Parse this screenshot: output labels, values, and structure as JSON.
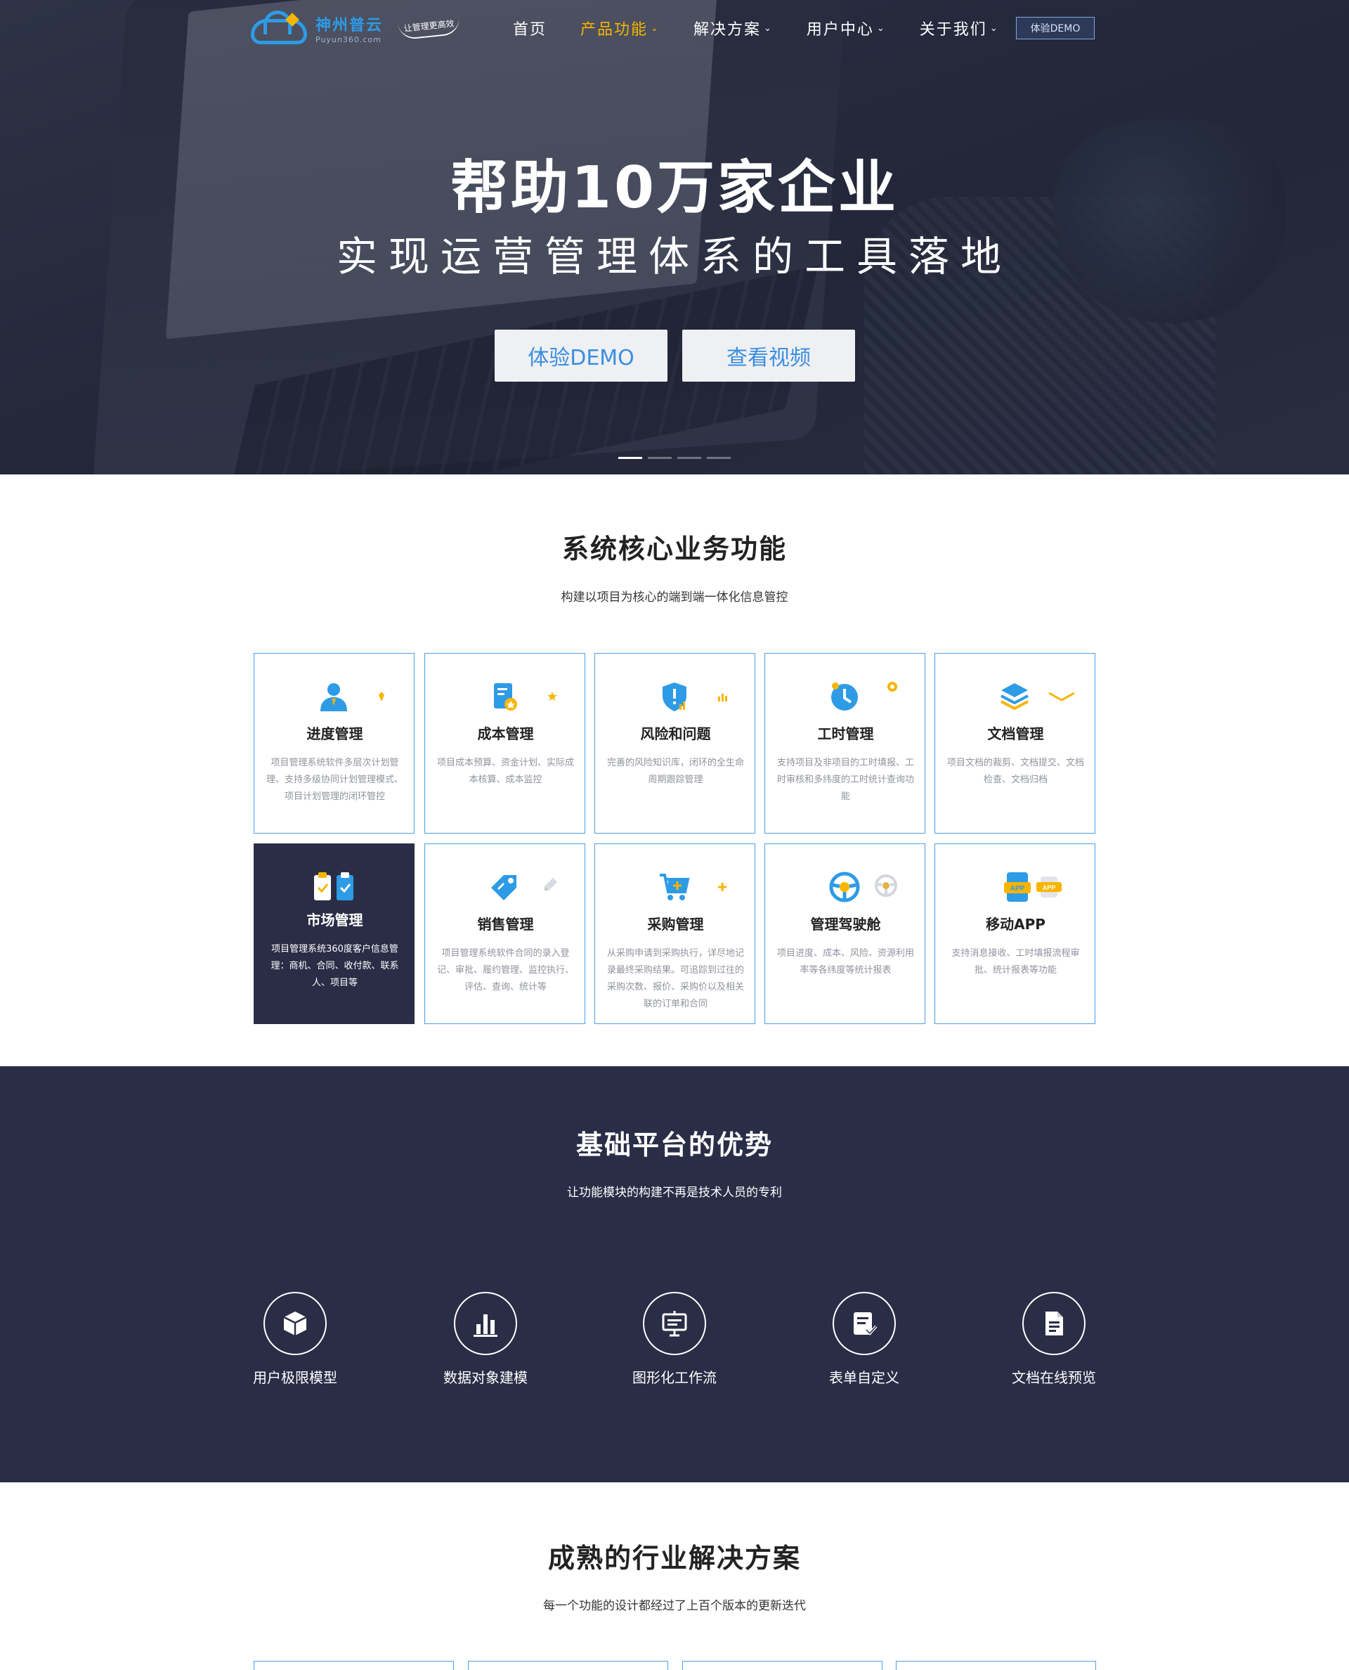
{
  "brand": {
    "name": "神州普云",
    "domain": "Puyun360.com",
    "slogan": "让管理更高效"
  },
  "nav": {
    "items": [
      {
        "label": "首页",
        "has_dropdown": false,
        "active": false
      },
      {
        "label": "产品功能",
        "has_dropdown": true,
        "active": true
      },
      {
        "label": "解决方案",
        "has_dropdown": true,
        "active": false
      },
      {
        "label": "用户中心",
        "has_dropdown": true,
        "active": false
      },
      {
        "label": "关于我们",
        "has_dropdown": true,
        "active": false
      }
    ],
    "demo_label": "体验DEMO",
    "chevron": "⌄"
  },
  "hero": {
    "title": "帮助10万家企业",
    "subtitle": "实现运营管理体系的工具落地",
    "demo_button": "体验DEMO",
    "video_button": "查看视频",
    "slides": 4,
    "active_slide": 0
  },
  "core": {
    "title": "系统核心业务功能",
    "subtitle": "构建以项目为核心的端到端一体化信息管控",
    "cards": [
      {
        "icon": "user-icon",
        "title": "进度管理",
        "desc": "项目管理系统软件多层次计划管理、支持多级协同计划管理模式、项目计划管理的闭环管控",
        "dark": false
      },
      {
        "icon": "document-coin-icon",
        "title": "成本管理",
        "desc": "项目成本预算、资金计划、实际成本核算、成本监控",
        "dark": false
      },
      {
        "icon": "shield-alert-icon",
        "title": "风险和问题",
        "desc": "完善的风险知识库，闭环的全生命周期跟踪管理",
        "dark": false
      },
      {
        "icon": "clock-icon",
        "title": "工时管理",
        "desc": "支持项目及非项目的工时填报、工时审核和多纬度的工时统计查询功能",
        "dark": false
      },
      {
        "icon": "layers-icon",
        "title": "文档管理",
        "desc": "项目文档的裁剪、文档提交、文档检查、文档归档",
        "dark": false
      },
      {
        "icon": "clipboard-check-icon",
        "title": "市场管理",
        "desc": "项目管理系统360度客户信息管理：商机、合同、收付款、联系人、项目等",
        "dark": true
      },
      {
        "icon": "tag-icon",
        "title": "销售管理",
        "desc": "项目管理系统软件合同的录入登记、审批、履约管理、监控执行、评估、查询、统计等",
        "dark": false
      },
      {
        "icon": "cart-icon",
        "title": "采购管理",
        "desc": "从采购申请到采购执行，详尽地记录最终采购结果。可追踪到过往的采购次数、报价、采购价以及相关联的订单和合同",
        "dark": false
      },
      {
        "icon": "steering-wheel-icon",
        "title": "管理驾驶舱",
        "desc": "项目进度、成本、风险、资源利用率等各纬度等统计报表",
        "dark": false
      },
      {
        "icon": "mobile-app-icon",
        "title": "移动APP",
        "desc": "支持消息接收、工时填报流程审批、统计报表等功能",
        "dark": false
      }
    ],
    "app_badge": "APP"
  },
  "platform": {
    "title": "基础平台的优势",
    "subtitle": "让功能模块的构建不再是技术人员的专利",
    "features": [
      {
        "icon": "cube-icon",
        "label": "用户极限模型"
      },
      {
        "icon": "bar-chart-icon",
        "label": "数据对象建模"
      },
      {
        "icon": "presentation-icon",
        "label": "图形化工作流"
      },
      {
        "icon": "form-check-icon",
        "label": "表单自定义"
      },
      {
        "icon": "file-icon",
        "label": "文档在线预览"
      }
    ]
  },
  "solutions": {
    "title": "成熟的行业解决方案",
    "subtitle": "每一个功能的设计都经过了上百个版本的更新迭代"
  },
  "colors": {
    "accent_blue": "#2e9be6",
    "accent_yellow": "#f7b500",
    "dark_navy": "#2a2d46",
    "card_border": "#4aa0e6"
  }
}
